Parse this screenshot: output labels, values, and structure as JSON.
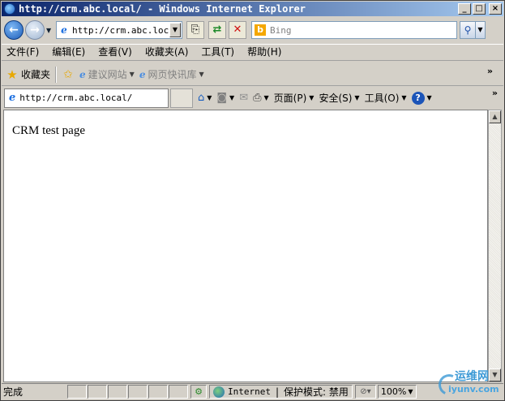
{
  "window": {
    "title": "http://crm.abc.local/ - Windows Internet Explorer",
    "min": "_",
    "max": "□",
    "close": "×"
  },
  "nav": {
    "address": "http://crm.abc.local/",
    "search_placeholder": "Bing",
    "search_icon": "magnifier-icon"
  },
  "menu": {
    "items": [
      "文件(F)",
      "编辑(E)",
      "查看(V)",
      "收藏夹(A)",
      "工具(T)",
      "帮助(H)"
    ]
  },
  "favorites": {
    "label": "收藏夹",
    "links": [
      "建议网站",
      "网页快讯库"
    ]
  },
  "tab": {
    "title": "http://crm.abc.local/"
  },
  "commands": {
    "page": "页面(P)",
    "safety": "安全(S)",
    "tools": "工具(O)"
  },
  "content": {
    "text": "CRM test page"
  },
  "status": {
    "text": "完成",
    "zone": "Internet",
    "protected_mode": "保护模式: 禁用",
    "zoom": "100%"
  },
  "watermark": {
    "main": "运维网",
    "sub": "iyunv.com"
  },
  "colors": {
    "title_start": "#0a246a",
    "title_end": "#a6caf0",
    "chrome": "#d4d0c8"
  }
}
